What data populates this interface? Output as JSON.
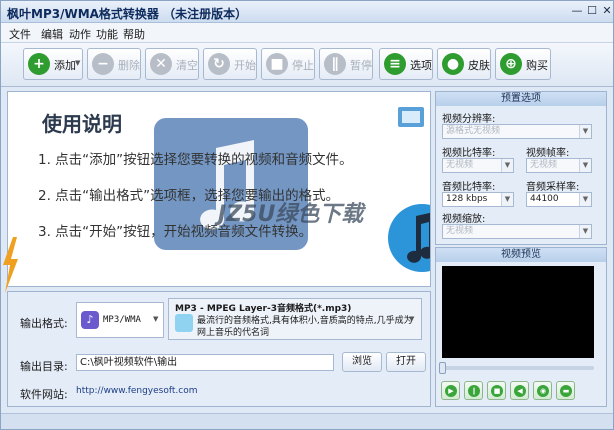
{
  "window": {
    "title": "枫叶MP3/WMA格式转换器 （未注册版本）"
  },
  "menu": [
    "文件",
    "编辑",
    "动作",
    "功能",
    "帮助"
  ],
  "toolbar": {
    "add": "添加",
    "delete": "删除",
    "clear": "清空",
    "start": "开始",
    "stop": "停止",
    "pause": "暂停",
    "options": "选项",
    "skin": "皮肤",
    "buy": "购买"
  },
  "instructions": {
    "heading": "使用说明",
    "steps": [
      "1. 点击“添加”按钮选择您要转换的视频和音频文件。",
      "2. 点击“输出格式”选项框，选择您要输出的格式。",
      "3. 点击“开始”按钮，开始视频音频文件转换。"
    ]
  },
  "watermark": "JZ5U绿色下载",
  "output": {
    "format_label": "输出格式:",
    "format_value": "MP3/WMA",
    "format_desc_title": "MP3 - MPEG Layer-3音频格式(*.mp3)",
    "format_desc_line1": "最流行的音频格式,具有体积小,音质高的特点,几乎成为",
    "format_desc_line2": "网上音乐的代名词",
    "dir_label": "输出目录:",
    "dir_value": "C:\\枫叶视频软件\\输出",
    "browse": "浏览",
    "open": "打开",
    "website_label": "软件网站:",
    "website_url": "http://www.fengyesoft.com"
  },
  "preset": {
    "header": "预置选项",
    "resolution_label": "视频分辨率:",
    "resolution_value": "源格式无视频",
    "video_bitrate_label": "视频比特率:",
    "video_bitrate_value": "无视频",
    "framerate_label": "视频帧率:",
    "framerate_value": "无视频",
    "audio_bitrate_label": "音频比特率:",
    "audio_bitrate_value": "128 kbps",
    "samplerate_label": "音频采样率:",
    "samplerate_value": "44100",
    "scale_label": "视频缩放:",
    "scale_value": "无视频"
  },
  "preview": {
    "header": "视频预览",
    "progress": 0
  },
  "colors": {
    "accent": "#2b8a2b",
    "panel": "#e4ecf7",
    "border": "#9fb4d0"
  }
}
